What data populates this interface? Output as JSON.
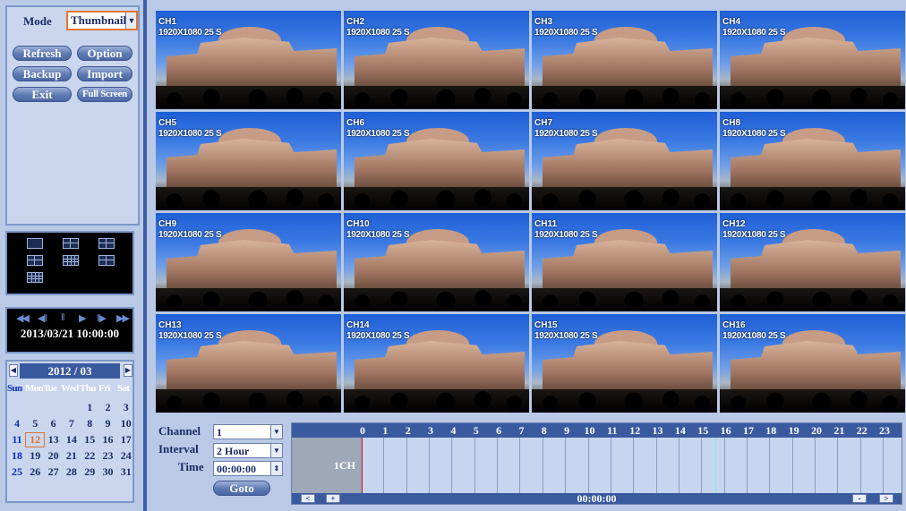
{
  "mode": {
    "label": "Mode",
    "value": "Thumbnail"
  },
  "buttons": {
    "refresh": "Refresh",
    "option": "Option",
    "backup": "Backup",
    "import": "Import",
    "exit": "Exit",
    "full_screen": "Full Screen"
  },
  "playback": {
    "controls": [
      "◀◀",
      "◀‖",
      "‖",
      "▶",
      "‖▶",
      "▶▶"
    ],
    "datetime": "2013/03/21 10:00:00"
  },
  "calendar": {
    "title": "2012 / 03",
    "dow": [
      "Sun",
      "Mon",
      "Tue",
      "Wed",
      "Thu",
      "Fri",
      "Sat"
    ],
    "weeks": [
      [
        "",
        "",
        "",
        "",
        "1",
        "2",
        "3"
      ],
      [
        "4",
        "5",
        "6",
        "7",
        "8",
        "9",
        "10"
      ],
      [
        "11",
        "12",
        "13",
        "14",
        "15",
        "16",
        "17"
      ],
      [
        "18",
        "19",
        "20",
        "21",
        "22",
        "23",
        "24"
      ],
      [
        "25",
        "26",
        "27",
        "28",
        "29",
        "30",
        "31"
      ]
    ],
    "selected": "12"
  },
  "channels": [
    {
      "name": "CH1",
      "res": "1920X1080 25 S"
    },
    {
      "name": "CH2",
      "res": "1920X1080 25 S"
    },
    {
      "name": "CH3",
      "res": "1920X1080 25 S"
    },
    {
      "name": "CH4",
      "res": "1920X1080 25 S"
    },
    {
      "name": "CH5",
      "res": "1920X1080 25 S"
    },
    {
      "name": "CH6",
      "res": "1920X1080 25 S"
    },
    {
      "name": "CH7",
      "res": "1920X1080 25 S"
    },
    {
      "name": "CH8",
      "res": "1920X1080 25 S"
    },
    {
      "name": "CH9",
      "res": "1920X1080 25 S"
    },
    {
      "name": "CH10",
      "res": "1920X1080 25 S"
    },
    {
      "name": "CH11",
      "res": "1920X1080 25 S"
    },
    {
      "name": "CH12",
      "res": "1920X1080 25 S"
    },
    {
      "name": "CH13",
      "res": "1920X1080 25 S"
    },
    {
      "name": "CH14",
      "res": "1920X1080 25 S"
    },
    {
      "name": "CH15",
      "res": "1920X1080 25 S"
    },
    {
      "name": "CH16",
      "res": "1920X1080 25 S"
    }
  ],
  "controls": {
    "channel_label": "Channel",
    "channel_value": "1",
    "interval_label": "Interval",
    "interval_value": "2 Hour",
    "time_label": "Time",
    "time_value": "00:00:00",
    "goto_label": "Goto"
  },
  "timeline": {
    "hours": [
      "0",
      "1",
      "2",
      "3",
      "4",
      "5",
      "6",
      "7",
      "8",
      "9",
      "10",
      "11",
      "12",
      "13",
      "14",
      "15",
      "16",
      "17",
      "18",
      "19",
      "20",
      "21",
      "22",
      "23"
    ],
    "row_label": "1CH",
    "current_time": "00:00:00",
    "btn_prev": "<",
    "btn_plus": "+",
    "btn_minus": "-",
    "btn_next": ">"
  },
  "colors": {
    "accent": "#3a5aa0",
    "cursor": "#e01010",
    "selection": "#e2772c"
  }
}
